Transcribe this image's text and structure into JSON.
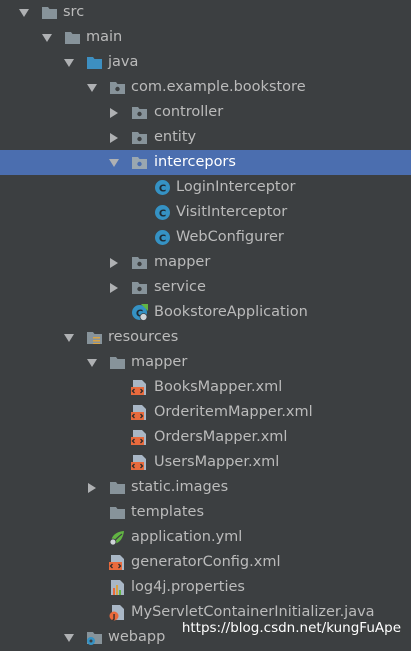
{
  "project_tree": {
    "items": [
      {
        "label": "src",
        "icon": "folder-icon",
        "expanded": true
      },
      {
        "label": "main",
        "icon": "folder-icon",
        "expanded": true
      },
      {
        "label": "java",
        "icon": "source-folder-icon",
        "expanded": true
      },
      {
        "label": "com.example.bookstore",
        "icon": "package-icon",
        "expanded": true
      },
      {
        "label": "controller",
        "icon": "package-icon",
        "expanded": false
      },
      {
        "label": "entity",
        "icon": "package-icon",
        "expanded": false
      },
      {
        "label": "intercepors",
        "icon": "package-icon",
        "expanded": true,
        "selected": true
      },
      {
        "label": "LoginInterceptor",
        "icon": "java-class-icon"
      },
      {
        "label": "VisitInterceptor",
        "icon": "java-class-icon"
      },
      {
        "label": "WebConfigurer",
        "icon": "java-class-icon"
      },
      {
        "label": "mapper",
        "icon": "package-icon",
        "expanded": false
      },
      {
        "label": "service",
        "icon": "package-icon",
        "expanded": false
      },
      {
        "label": "BookstoreApplication",
        "icon": "spring-boot-app-icon"
      },
      {
        "label": "resources",
        "icon": "resources-folder-icon",
        "expanded": true
      },
      {
        "label": "mapper",
        "icon": "folder-icon",
        "expanded": true
      },
      {
        "label": "BooksMapper.xml",
        "icon": "xml-file-icon"
      },
      {
        "label": "OrderitemMapper.xml",
        "icon": "xml-file-icon"
      },
      {
        "label": "OrdersMapper.xml",
        "icon": "xml-file-icon"
      },
      {
        "label": "UsersMapper.xml",
        "icon": "xml-file-icon"
      },
      {
        "label": "static.images",
        "icon": "folder-icon",
        "expanded": false
      },
      {
        "label": "templates",
        "icon": "folder-icon"
      },
      {
        "label": "application.yml",
        "icon": "spring-yml-icon"
      },
      {
        "label": "generatorConfig.xml",
        "icon": "xml-file-icon"
      },
      {
        "label": "log4j.properties",
        "icon": "properties-file-icon"
      },
      {
        "label": "MyServletContainerInitializer.java",
        "icon": "java-file-icon"
      },
      {
        "label": "webapp",
        "icon": "web-folder-icon",
        "expanded": true
      }
    ]
  },
  "watermark": "https://blog.csdn.net/kungFuApe",
  "colors": {
    "background": "#3c3f41",
    "selection": "#4b6eaf",
    "text": "#bbbbbb",
    "folder": "#87939a",
    "class_icon": "#3592c4",
    "xml_icon": "#e96a3d"
  }
}
